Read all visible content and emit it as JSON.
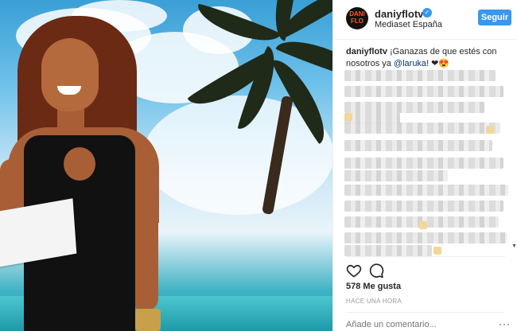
{
  "post": {
    "image_alt": "",
    "header": {
      "avatar_text": "DANI\nFLO",
      "username": "daniyflotv",
      "location": "Mediaset España",
      "follow_label": "Seguir"
    },
    "caption": {
      "username": "daniyflotv",
      "text": "¡Ganazas de que estés con nosotros ya ",
      "mention": "@laruka",
      "suffix": "! ❤😍"
    },
    "likes_label": "578 Me gusta",
    "timestamp": "HACE UNA HORA",
    "comment_placeholder": "Añade un comentario...",
    "more_label": "···",
    "icons": [
      "heart-icon",
      "comment-icon",
      "verified-badge-icon",
      "more-options-icon"
    ],
    "colors": {
      "accent": "#3897f0",
      "mention": "#003569",
      "brand_orange": "#ff5a1f"
    }
  }
}
